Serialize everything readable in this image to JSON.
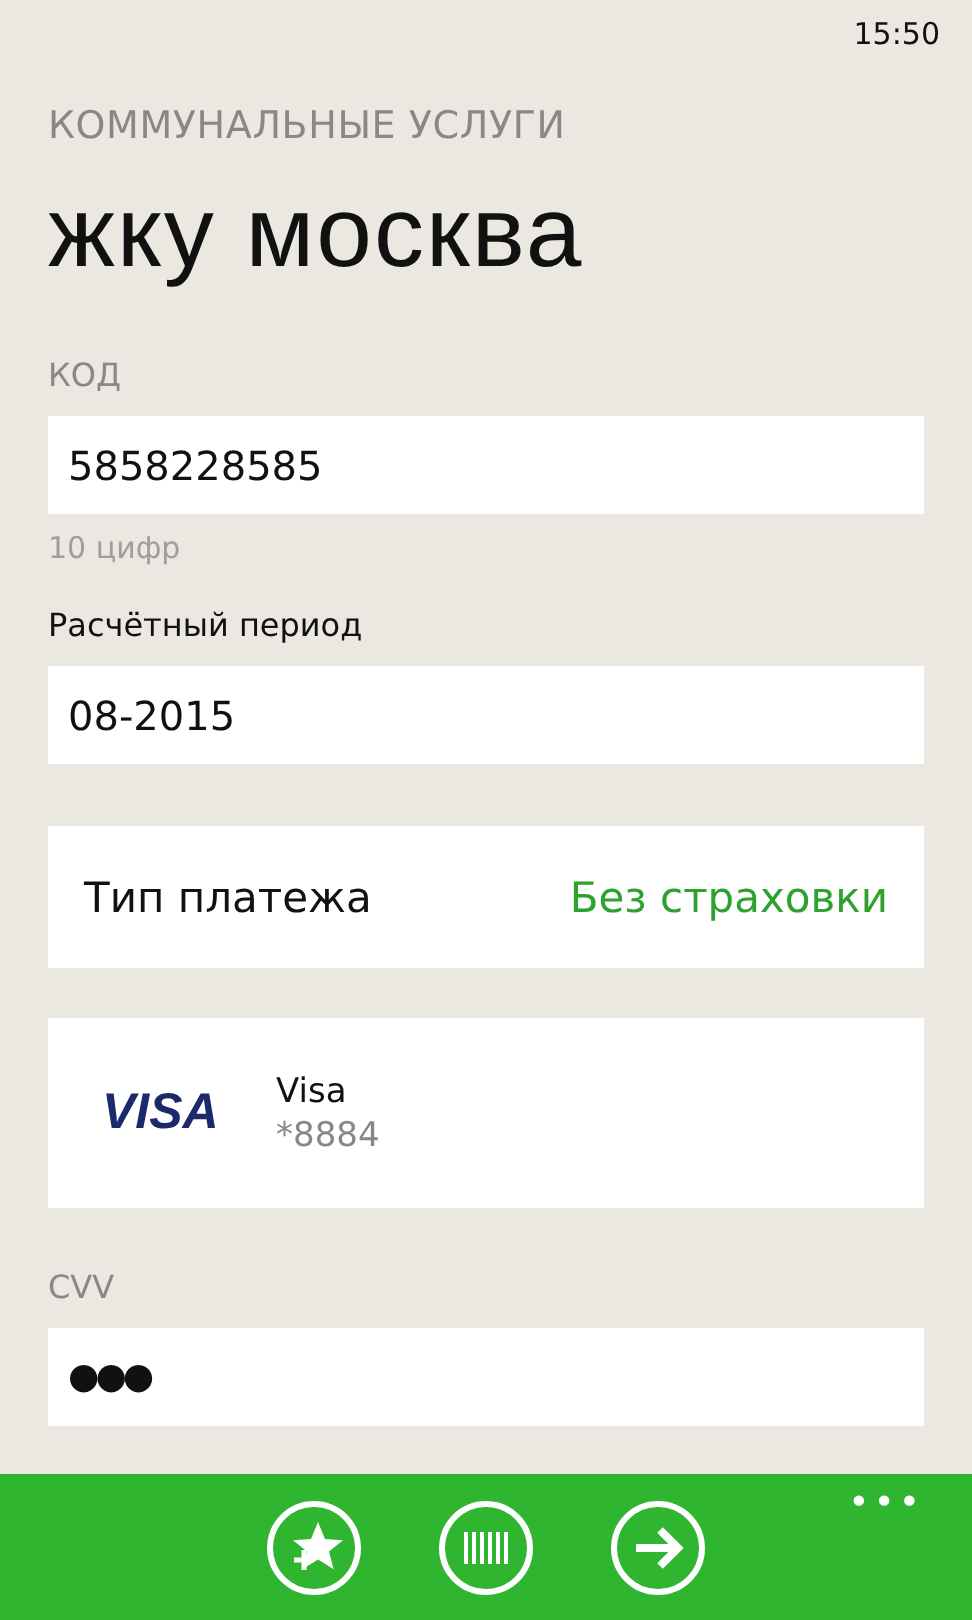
{
  "status_bar": {
    "time": "15:50"
  },
  "header": {
    "category": "КОММУНАЛЬНЫЕ УСЛУГИ",
    "title": "жку москва"
  },
  "fields": [
    {
      "kind": "caption",
      "label": "КОД",
      "value": "5858228585",
      "hint": "10 цифр"
    },
    {
      "kind": "plain",
      "label": "Расчётный период",
      "value": "08-2015"
    }
  ],
  "payment_type": {
    "label": "Тип платежа",
    "value": "Без страховки"
  },
  "card": {
    "brand": "VISA",
    "name": "Visa",
    "number": "*8884"
  },
  "cvv": {
    "label": "CVV",
    "value": "●●●"
  },
  "app_bar": {
    "buttons": [
      {
        "kind": "favorite"
      },
      {
        "kind": "barcode"
      },
      {
        "kind": "next"
      }
    ],
    "more": "•••"
  }
}
